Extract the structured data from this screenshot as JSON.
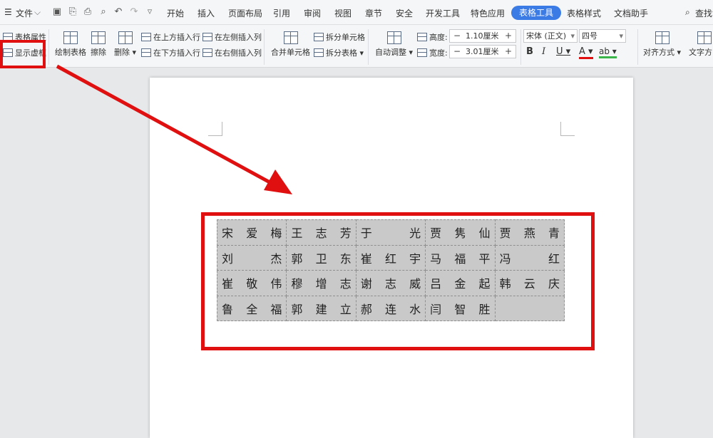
{
  "menubar": {
    "file": "文件",
    "tabs": [
      "开始",
      "插入",
      "页面布局",
      "引用",
      "审阅",
      "视图",
      "章节",
      "安全",
      "开发工具",
      "特色应用",
      "表格工具",
      "表格样式",
      "文档助手"
    ],
    "active_tab": "表格工具",
    "search": "查找命"
  },
  "ribbon": {
    "table_props": "表格属性",
    "show_gridlines": "显示虚框",
    "draw_table": "绘制表格",
    "erase": "擦除",
    "delete": "删除",
    "insert_above": "在上方插入行",
    "insert_below": "在下方插入行",
    "insert_left": "在左侧插入列",
    "insert_right": "在右侧插入列",
    "merge_cells": "合并单元格",
    "split_cells": "拆分单元格",
    "split_table": "拆分表格",
    "autofit": "自动调整",
    "height_label": "高度:",
    "height_value": "1.10厘米",
    "width_label": "宽度:",
    "width_value": "3.01厘米",
    "font_name": "宋体 (正文)",
    "font_size": "四号",
    "bold": "B",
    "italic": "I",
    "underline": "U",
    "font_color": "A",
    "highlight": "ab",
    "align": "对齐方式",
    "text_dir": "文字方向"
  },
  "table": {
    "rows": [
      [
        [
          "宋",
          "爱",
          "梅"
        ],
        [
          "王",
          "志",
          "芳"
        ],
        [
          "于",
          "",
          "光"
        ],
        [
          "贾",
          "隽",
          "仙"
        ],
        [
          "贾",
          "燕",
          "青"
        ]
      ],
      [
        [
          "刘",
          "",
          "杰"
        ],
        [
          "郭",
          "卫",
          "东"
        ],
        [
          "崔",
          "红",
          "宇"
        ],
        [
          "马",
          "福",
          "平"
        ],
        [
          "冯",
          "",
          "红"
        ]
      ],
      [
        [
          "崔",
          "敬",
          "伟"
        ],
        [
          "穆",
          "增",
          "志"
        ],
        [
          "谢",
          "志",
          "威"
        ],
        [
          "吕",
          "金",
          "起"
        ],
        [
          "韩",
          "云",
          "庆"
        ]
      ],
      [
        [
          "鲁",
          "全",
          "福"
        ],
        [
          "郭",
          "建",
          "立"
        ],
        [
          "郝",
          "连",
          "水"
        ],
        [
          "闫",
          "智",
          "胜"
        ],
        [
          "",
          "",
          ""
        ]
      ]
    ]
  },
  "colors": {
    "accent": "#3b7be5",
    "annotation": "#e01010",
    "table_fill": "#c9c9c9"
  }
}
